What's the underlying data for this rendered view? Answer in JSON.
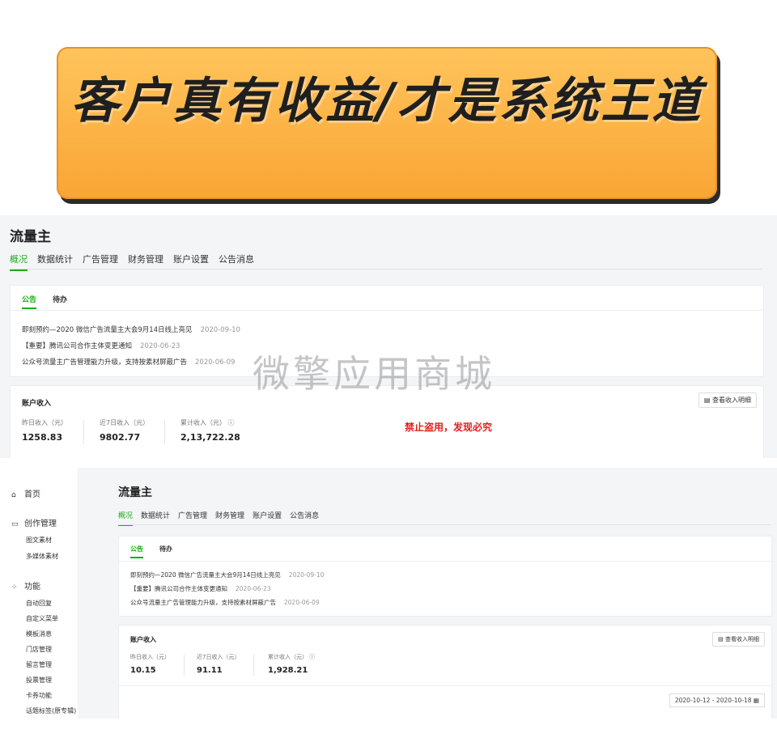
{
  "banner": {
    "title": "客户真有收益/才是系统王道"
  },
  "watermark": "微擎应用商城",
  "shot1": {
    "app_title": "流量主",
    "tabs": [
      "概况",
      "数据统计",
      "广告管理",
      "财务管理",
      "账户设置",
      "公告消息"
    ],
    "card_tabs": [
      "公告",
      "待办"
    ],
    "notices": [
      {
        "text": "即刻预约—2020 微信广告流量主大会9月14日线上亮见",
        "date": "2020-09-10"
      },
      {
        "text": "【重要】腾讯公司合作主体变更通知",
        "date": "2020-06-23"
      },
      {
        "text": "公众号流量主广告管理能力升级，支持按素材屏蔽广告",
        "date": "2020-06-09"
      }
    ],
    "income_title": "账户收入",
    "detail_button": "查看收入明细",
    "stats": [
      {
        "label": "昨日收入（元）",
        "value": "1258.83"
      },
      {
        "label": "近7日收入（元）",
        "value": "9802.77"
      },
      {
        "label": "累计收入（元）",
        "value": "2,13,722.28"
      }
    ],
    "warning": "禁止盗用，发现必究"
  },
  "shot2": {
    "sidebar": {
      "home": "首页",
      "creation": "创作管理",
      "creation_items": [
        "图文素材",
        "多媒体素材"
      ],
      "functions": "功能",
      "function_items": [
        "自动回复",
        "自定义菜单",
        "模板消息",
        "门店管理",
        "留言管理",
        "投票管理",
        "卡券功能",
        "话题标签(原专辑)"
      ]
    },
    "app_title": "流量主",
    "tabs": [
      "概况",
      "数据统计",
      "广告管理",
      "财务管理",
      "账户设置",
      "公告消息"
    ],
    "card_tabs": [
      "公告",
      "待办"
    ],
    "notices": [
      {
        "text": "即刻预约—2020 微信广告流量主大会9月14日线上亮见",
        "date": "2020-09-10"
      },
      {
        "text": "【重要】腾讯公司合作主体变更通知",
        "date": "2020-06-23"
      },
      {
        "text": "公众号流量主广告管理能力升级，支持按素材屏蔽广告",
        "date": "2020-06-09"
      }
    ],
    "income_title": "账户收入",
    "detail_button": "查看收入明细",
    "stats": [
      {
        "label": "昨日收入（元）",
        "value": "10.15"
      },
      {
        "label": "近7日收入（元）",
        "value": "91.11"
      },
      {
        "label": "累计收入（元）",
        "value": "1,928.21"
      }
    ],
    "date_range": "2020-10-12 - 2020-10-18"
  }
}
